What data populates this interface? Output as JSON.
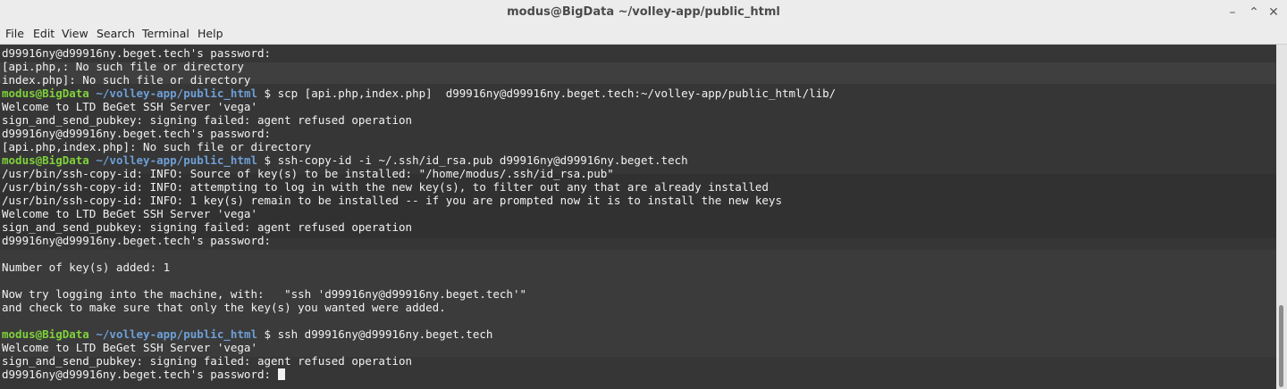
{
  "window": {
    "title": "modus@BigData ~/volley-app/public_html"
  },
  "window_controls": {
    "minimize": "–",
    "maximize": "⌃",
    "close": "✕"
  },
  "menu": [
    "File",
    "Edit",
    "View",
    "Search",
    "Terminal",
    "Help"
  ],
  "prompt": {
    "user_host": "modus@BigData",
    "path": "~/volley-app/public_html",
    "symbol": " $ "
  },
  "lines": [
    {
      "type": "out",
      "text": "d99916ny@d99916ny.beget.tech's password: "
    },
    {
      "type": "out",
      "text": "[api.php,: No such file or directory"
    },
    {
      "type": "out",
      "text": "index.php]: No such file or directory"
    },
    {
      "type": "cmd",
      "text": "scp [api.php,index.php]  d99916ny@d99916ny.beget.tech:~/volley-app/public_html/lib/"
    },
    {
      "type": "out",
      "text": "Welcome to LTD BeGet SSH Server 'vega'"
    },
    {
      "type": "out",
      "text": "sign_and_send_pubkey: signing failed: agent refused operation"
    },
    {
      "type": "out",
      "text": "d99916ny@d99916ny.beget.tech's password: "
    },
    {
      "type": "out",
      "text": "[api.php,index.php]: No such file or directory"
    },
    {
      "type": "cmd",
      "text": "ssh-copy-id -i ~/.ssh/id_rsa.pub d99916ny@d99916ny.beget.tech"
    },
    {
      "type": "out",
      "text": "/usr/bin/ssh-copy-id: INFO: Source of key(s) to be installed: \"/home/modus/.ssh/id_rsa.pub\""
    },
    {
      "type": "out",
      "text": "/usr/bin/ssh-copy-id: INFO: attempting to log in with the new key(s), to filter out any that are already installed"
    },
    {
      "type": "out",
      "text": "/usr/bin/ssh-copy-id: INFO: 1 key(s) remain to be installed -- if you are prompted now it is to install the new keys"
    },
    {
      "type": "out",
      "text": "Welcome to LTD BeGet SSH Server 'vega'"
    },
    {
      "type": "out",
      "text": "sign_and_send_pubkey: signing failed: agent refused operation"
    },
    {
      "type": "out",
      "text": "d99916ny@d99916ny.beget.tech's password: "
    },
    {
      "type": "out",
      "text": ""
    },
    {
      "type": "out",
      "text": "Number of key(s) added: 1"
    },
    {
      "type": "out",
      "text": ""
    },
    {
      "type": "out",
      "text": "Now try logging into the machine, with:   \"ssh 'd99916ny@d99916ny.beget.tech'\""
    },
    {
      "type": "out",
      "text": "and check to make sure that only the key(s) you wanted were added."
    },
    {
      "type": "out",
      "text": ""
    },
    {
      "type": "cmd",
      "text": "ssh d99916ny@d99916ny.beget.tech"
    },
    {
      "type": "out",
      "text": "Welcome to LTD BeGet SSH Server 'vega'"
    },
    {
      "type": "out",
      "text": "sign_and_send_pubkey: signing failed: agent refused operation"
    },
    {
      "type": "final",
      "text": "d99916ny@d99916ny.beget.tech's password: "
    }
  ]
}
